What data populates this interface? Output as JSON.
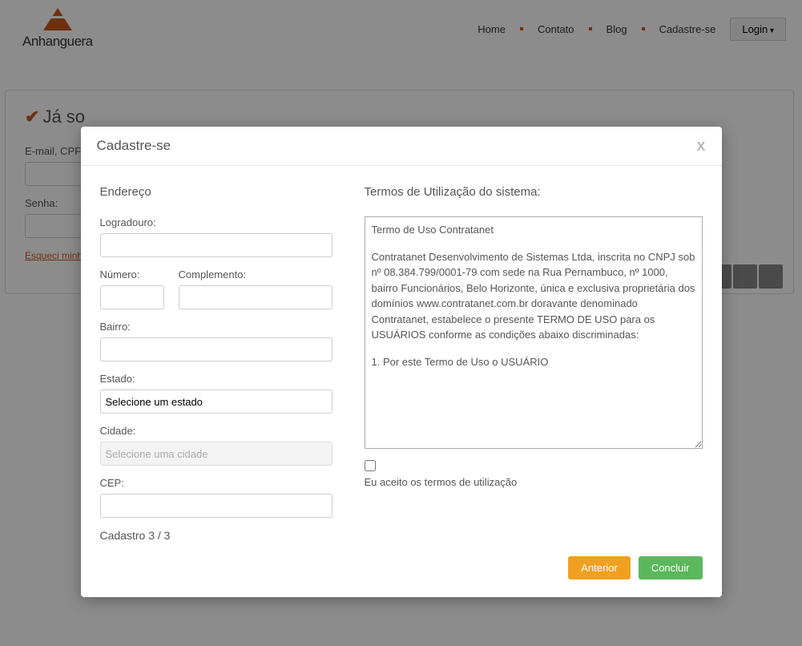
{
  "brand": "Anhanguera",
  "nav": {
    "home": "Home",
    "contato": "Contato",
    "blog": "Blog",
    "cadastre": "Cadastre-se",
    "login": "Login"
  },
  "bg": {
    "ja_sou": "Já so",
    "email_label": "E-mail, CPF",
    "senha_label": "Senha:",
    "forgot": "Esqueci minh"
  },
  "modal": {
    "title": "Cadastre-se",
    "close": "x",
    "left_title": "Endereço",
    "right_title": "Termos de Utilização do sistema:",
    "fields": {
      "logradouro": "Logradouro:",
      "numero": "Número:",
      "complemento": "Complemento:",
      "bairro": "Bairro:",
      "estado": "Estado:",
      "cidade": "Cidade:",
      "cep": "CEP:"
    },
    "estado_placeholder": "Selecione um estado",
    "cidade_placeholder": "Selecione uma cidade",
    "progress": "Cadastro 3 / 3",
    "terms_p1": "Termo de Uso Contratanet",
    "terms_p2": "Contratanet Desenvolvimento de Sistemas Ltda, inscrita no CNPJ sob nº 08.384.799/0001-79 com sede na Rua Pernambuco, nº 1000, bairro Funcionários, Belo Horizonte, única e exclusiva proprietária dos domínios www.contratanet.com.br doravante denominado Contratanet, estabelece o presente TERMO DE USO para os USUÁRIOS conforme as condições abaixo discriminadas:",
    "terms_p3": "1. Por este Termo de Uso o USUÁRIO",
    "accept_label": "Eu aceito os termos de utilização",
    "btn_prev": "Anterior",
    "btn_done": "Concluir"
  }
}
